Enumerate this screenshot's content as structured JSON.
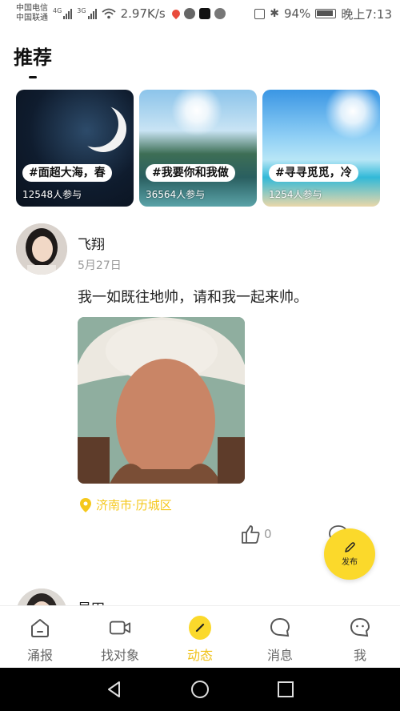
{
  "status_bar": {
    "carrier_1": "中国电信",
    "carrier_2": "中国联通",
    "network_1": "4G",
    "network_2": "3G",
    "speed": "2.97K/s",
    "battery": "94%",
    "time": "晚上7:13"
  },
  "page": {
    "title": "推荐"
  },
  "topics": [
    {
      "tag": "#面超大海，春",
      "participants": "12548人参与"
    },
    {
      "tag": "#我要你和我做",
      "participants": "36564人参与"
    },
    {
      "tag": "#寻寻觅觅，冷",
      "participants": "1254人参与"
    }
  ],
  "post": {
    "username": "飞翔",
    "date": "5月27日",
    "text": "我一如既往地帅，请和我一起来帅。",
    "location": "济南市·历城区",
    "like_count": "0"
  },
  "post2": {
    "username": "星田"
  },
  "fab": {
    "label": "发布"
  },
  "tabs": [
    {
      "label": "涌报",
      "icon": "home-icon"
    },
    {
      "label": "找对象",
      "icon": "video-icon"
    },
    {
      "label": "动态",
      "icon": "pen-icon",
      "active": true
    },
    {
      "label": "消息",
      "icon": "chat-bubble-icon"
    },
    {
      "label": "我",
      "icon": "face-icon"
    }
  ],
  "colors": {
    "accent": "#fbd92b",
    "accent_text": "#f0c21a",
    "location": "#f5c81c"
  }
}
